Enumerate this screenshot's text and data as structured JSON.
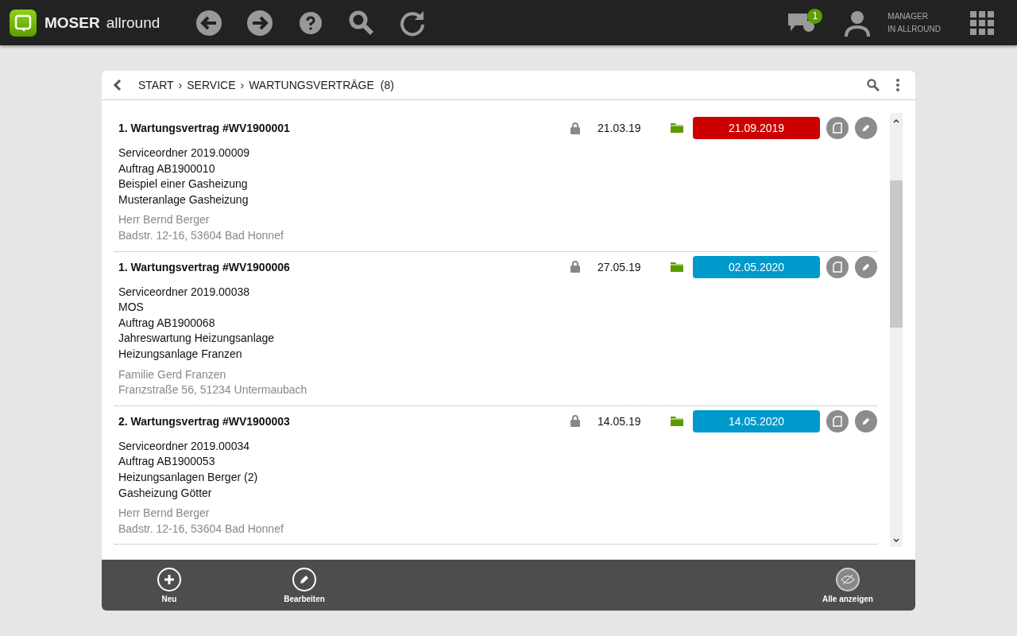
{
  "app": {
    "brand": "MOSER",
    "product": "allround",
    "messages_badge": "1",
    "user_role": "MANAGER",
    "user_context": "IN ALLROUND"
  },
  "breadcrumb": {
    "items": [
      "START",
      "SERVICE",
      "WARTUNGSVERTRÄGE"
    ],
    "separator": "›",
    "count": "(8)"
  },
  "contracts": [
    {
      "title": "1. Wartungsvertrag #WV1900001",
      "date": "21.03.19",
      "due": "21.09.2019",
      "color": "#cc0000",
      "lines": [
        "Serviceordner 2019.00009",
        "Auftrag AB1900010",
        "Beispiel einer Gasheizung",
        "Musteranlage Gasheizung"
      ],
      "contact": [
        "Herr Bernd Berger",
        "Badstr. 12-16, 53604 Bad Honnef"
      ]
    },
    {
      "title": "1. Wartungsvertrag #WV1900006",
      "date": "27.05.19",
      "due": "02.05.2020",
      "color": "#0099cc",
      "lines": [
        "Serviceordner 2019.00038",
        "MOS",
        "Auftrag AB1900068",
        "Jahreswartung Heizungsanlage",
        "Heizungsanlage Franzen"
      ],
      "contact": [
        "Familie Gerd Franzen",
        "Franzstraße 56, 51234 Untermaubach"
      ]
    },
    {
      "title": "2. Wartungsvertrag #WV1900003",
      "date": "14.05.19",
      "due": "14.05.2020",
      "color": "#0099cc",
      "lines": [
        "Serviceordner 2019.00034",
        "Auftrag AB1900053",
        "Heizungsanlagen Berger (2)",
        "Gasheizung Götter"
      ],
      "contact": [
        "Herr Bernd Berger",
        "Badstr. 12-16, 53604 Bad Honnef"
      ]
    }
  ],
  "footer_actions": [
    {
      "kind": "add",
      "label": "Neu"
    },
    {
      "kind": "edit",
      "label": "Bearbeiten"
    },
    {
      "kind": "spacer"
    },
    {
      "kind": "show",
      "label": "Alle anzeigen"
    }
  ]
}
